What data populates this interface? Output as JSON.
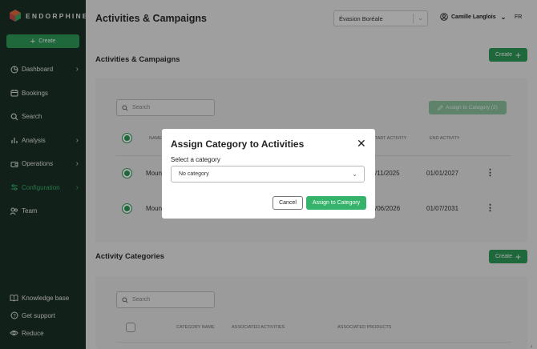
{
  "brand": {
    "name": "ENDORPHINE"
  },
  "sidebar": {
    "create_label": "Create",
    "items": [
      {
        "label": "Dashboard",
        "icon": "dashboard-icon",
        "has_children": true
      },
      {
        "label": "Bookings",
        "icon": "calendar-icon",
        "has_children": false
      },
      {
        "label": "Search",
        "icon": "search-icon",
        "has_children": false
      },
      {
        "label": "Analysis",
        "icon": "bar-chart-icon",
        "has_children": true
      },
      {
        "label": "Operations",
        "icon": "wallet-icon",
        "has_children": true
      },
      {
        "label": "Configuration",
        "icon": "settings-icon",
        "has_children": true,
        "active": true
      },
      {
        "label": "Team",
        "icon": "team-icon",
        "has_children": false
      }
    ],
    "bottom_items": [
      {
        "label": "Knowledge base",
        "icon": "book-icon"
      },
      {
        "label": "Get support",
        "icon": "help-icon"
      },
      {
        "label": "Reduce",
        "icon": "eye-icon"
      }
    ]
  },
  "header": {
    "title": "Activities & Campaigns",
    "organization": "Évasion Boréale",
    "user_name": "Camille Langlois",
    "language": "FR"
  },
  "activities_section": {
    "title": "Activities & Campaigns",
    "create_label": "Create",
    "search_placeholder": "Search",
    "assign_label": "Assign to Category (2)",
    "columns": [
      "NAME",
      "START ACTIVITY",
      "END ACTIVITY"
    ],
    "rows": [
      {
        "name": "Moun",
        "start": "/11/2025",
        "end": "01/01/2027",
        "checked": true
      },
      {
        "name": "Moun",
        "start": "/06/2026",
        "end": "01/07/2031",
        "checked": true
      }
    ]
  },
  "categories_section": {
    "title": "Activity Categories",
    "create_label": "Create",
    "search_placeholder": "Search",
    "columns": [
      "CATEGORY NAME",
      "ASSOCIATED ACTIVITIES",
      "ASSOCIATED PRODUCTS"
    ]
  },
  "modal": {
    "title": "Assign Category to Activities",
    "select_label": "Select a category",
    "select_value": "No category",
    "cancel_label": "Cancel",
    "confirm_label": "Assign to Category"
  },
  "colors": {
    "sidebar_bg": "#1c3027",
    "accent_green": "#2e9c58",
    "active_nav": "#37b06a"
  }
}
